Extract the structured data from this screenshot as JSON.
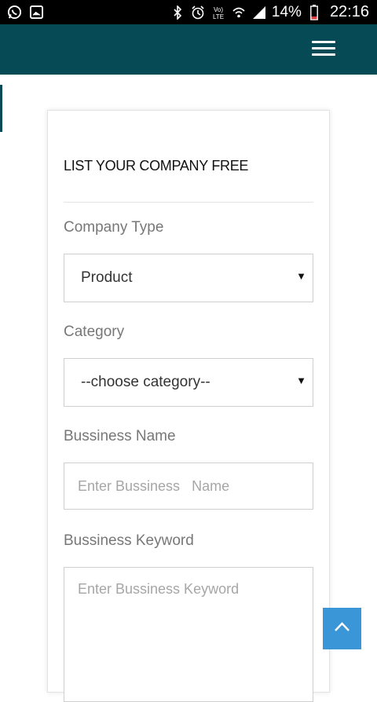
{
  "status_bar": {
    "battery_percent": "14%",
    "time": "22:16",
    "network_label": "Vo) LTE",
    "icons": [
      "whatsapp-icon",
      "gallery-icon",
      "bluetooth-icon",
      "alarm-icon",
      "volte-icon",
      "wifi-icon",
      "signal-icon",
      "battery-icon"
    ]
  },
  "header": {
    "menu_icon": "hamburger-menu-icon",
    "color": "#054a55"
  },
  "form": {
    "title": "LIST YOUR COMPANY FREE",
    "company_type": {
      "label": "Company Type",
      "value": "Product"
    },
    "category": {
      "label": "Category",
      "value": "--choose category--"
    },
    "business_name": {
      "label": "Bussiness Name",
      "placeholder": "Enter Bussiness   Name"
    },
    "business_keyword": {
      "label": "Bussiness Keyword",
      "placeholder": "Enter Bussiness Keyword"
    }
  },
  "scroll_top": {
    "icon": "chevron-up-icon",
    "color": "#3a96d6"
  }
}
